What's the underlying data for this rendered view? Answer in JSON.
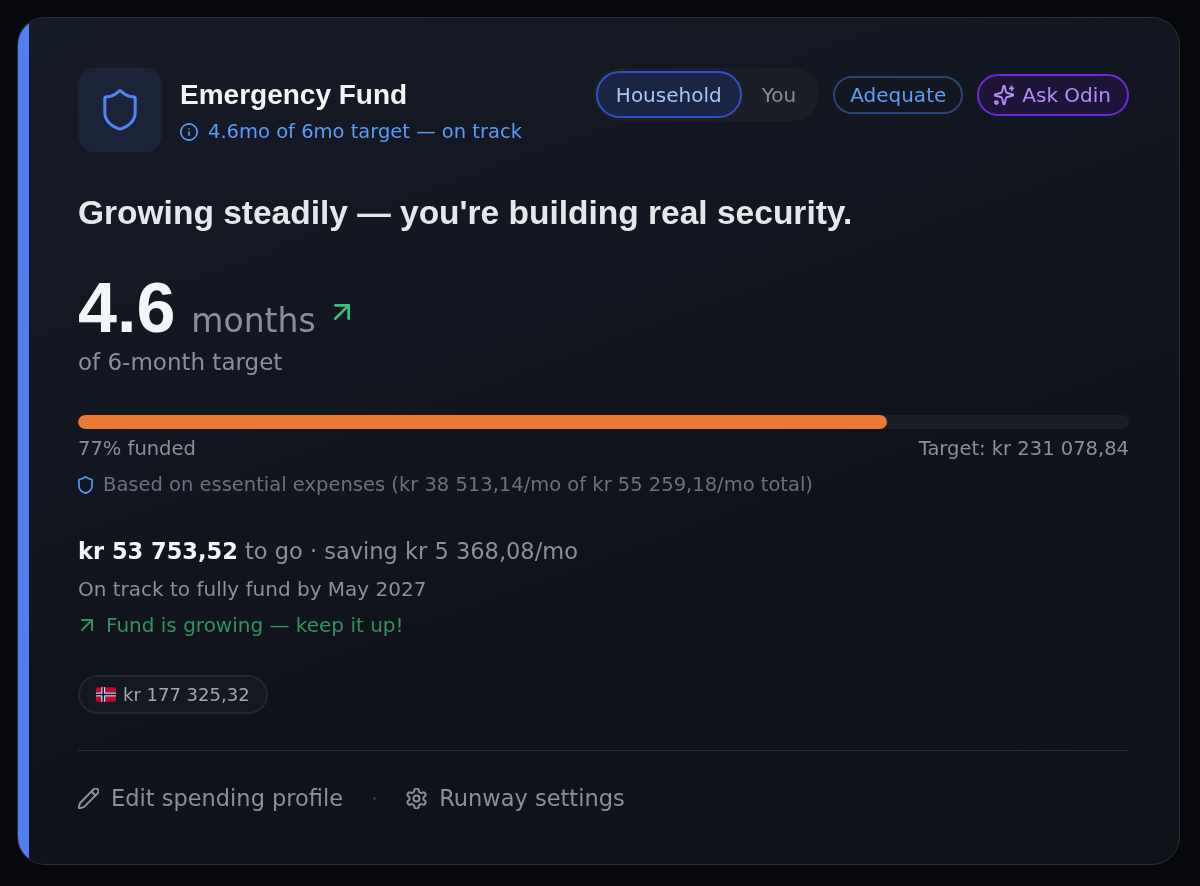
{
  "header": {
    "title": "Emergency Fund",
    "subtitle": "4.6mo of 6mo target — on track"
  },
  "scope_toggle": [
    {
      "label": "Household",
      "selected": true
    },
    {
      "label": "You",
      "selected": false
    }
  ],
  "status_badge": "Adequate",
  "ask_button": "Ask Odin",
  "headline": "Growing steadily — you're building real security.",
  "runway": {
    "value": "4.6",
    "unit": "months",
    "trend_up": true,
    "caption": "of 6-month target"
  },
  "progress": {
    "level": 0.77,
    "funded_label": "77% funded",
    "target_label": "Target: kr 231 078,84"
  },
  "basis_note": "Based on essential expenses (kr 38 513,14/mo of kr 55 259,18/mo total)",
  "gap_summary": "**kr 53 753,52** to go · saving kr 5 368,08/mo",
  "projection": "On track to fully fund by May 2027",
  "trend_message": "Fund is growing — keep it up!",
  "balance_chips": [
    {
      "amount": "kr 177 325,32"
    }
  ],
  "actions": [
    {
      "label": "Edit spending profile",
      "kind": "edit"
    },
    {
      "label": "Runway settings",
      "kind": "settings"
    }
  ]
}
